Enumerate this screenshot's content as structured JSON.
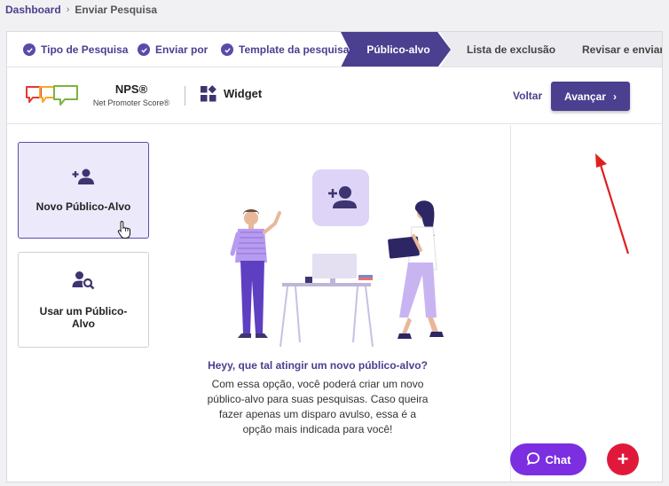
{
  "breadcrumb": {
    "home": "Dashboard",
    "current": "Enviar Pesquisa"
  },
  "stepper": {
    "steps": [
      {
        "label": "Tipo de Pesquisa",
        "done": true
      },
      {
        "label": "Enviar por",
        "done": true
      },
      {
        "label": "Template da pesquisa",
        "done": true
      },
      {
        "label": "Público-alvo",
        "active": true
      },
      {
        "label": "Lista de exclusão"
      },
      {
        "label": "Revisar e enviar"
      }
    ]
  },
  "product": {
    "title": "NPS®",
    "subtitle": "Net Promoter Score®",
    "channel": "Widget"
  },
  "actions": {
    "back": "Voltar",
    "next": "Avançar"
  },
  "options": [
    {
      "label": "Novo Público-Alvo",
      "icon": "add-person-icon",
      "selected": true
    },
    {
      "label": "Usar um Público-Alvo",
      "icon": "search-person-icon",
      "selected": false
    }
  ],
  "main": {
    "heading": "Heyy, que tal atingir um novo público-alvo?",
    "description": "Com essa opção, você poderá criar um novo público-alvo para suas pesquisas. Caso queira fazer apenas um disparo avulso, essa é a opção mais indicada para você!"
  },
  "chat": {
    "label": "Chat"
  },
  "colors": {
    "primary": "#4b3f8f",
    "accent": "#7b2fe0",
    "fab": "#e0193b",
    "selected_bg": "#ece9fb"
  }
}
